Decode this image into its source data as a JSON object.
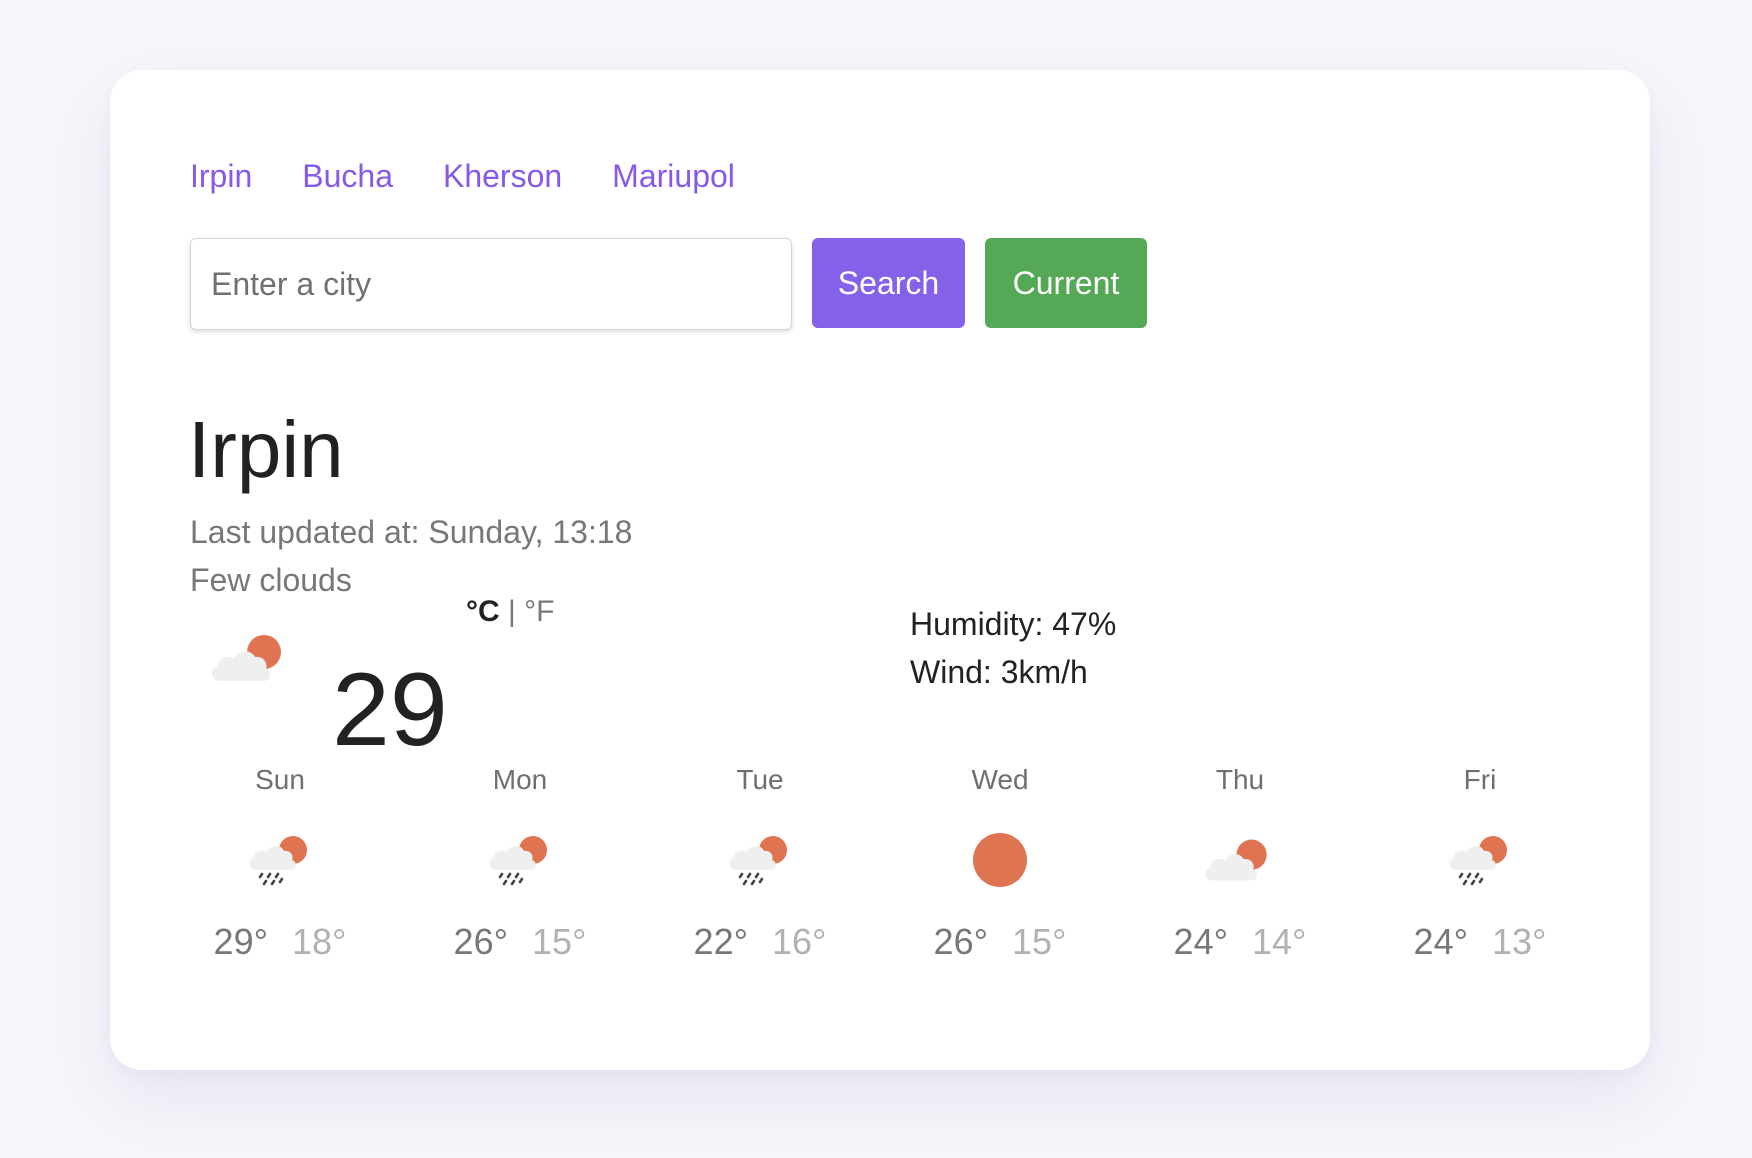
{
  "nav": {
    "cities": [
      "Irpin",
      "Bucha",
      "Kherson",
      "Mariupol"
    ]
  },
  "search": {
    "placeholder": "Enter a city",
    "search_label": "Search",
    "current_label": "Current"
  },
  "current": {
    "city": "Irpin",
    "last_updated": "Last updated at: Sunday, 13:18",
    "description": "Few clouds",
    "icon": "few-clouds-icon",
    "temperature": "29",
    "unit_c": "°C",
    "unit_separator": "|",
    "unit_f": "°F",
    "humidity": "Humidity: 47%",
    "wind": "Wind: 3km/h"
  },
  "forecast": [
    {
      "day": "Sun",
      "icon": "rain-sun-icon",
      "max": "29°",
      "min": "18°"
    },
    {
      "day": "Mon",
      "icon": "rain-sun-icon",
      "max": "26°",
      "min": "15°"
    },
    {
      "day": "Tue",
      "icon": "rain-sun-icon",
      "max": "22°",
      "min": "16°"
    },
    {
      "day": "Wed",
      "icon": "sun-icon",
      "max": "26°",
      "min": "15°"
    },
    {
      "day": "Thu",
      "icon": "few-clouds-icon",
      "max": "24°",
      "min": "14°"
    },
    {
      "day": "Fri",
      "icon": "rain-sun-icon",
      "max": "24°",
      "min": "13°"
    }
  ],
  "colors": {
    "accent": "#8659ea",
    "search_button": "#8560e8",
    "current_button": "#54a856",
    "sun": "#e07452",
    "cloud": "#efefef"
  }
}
